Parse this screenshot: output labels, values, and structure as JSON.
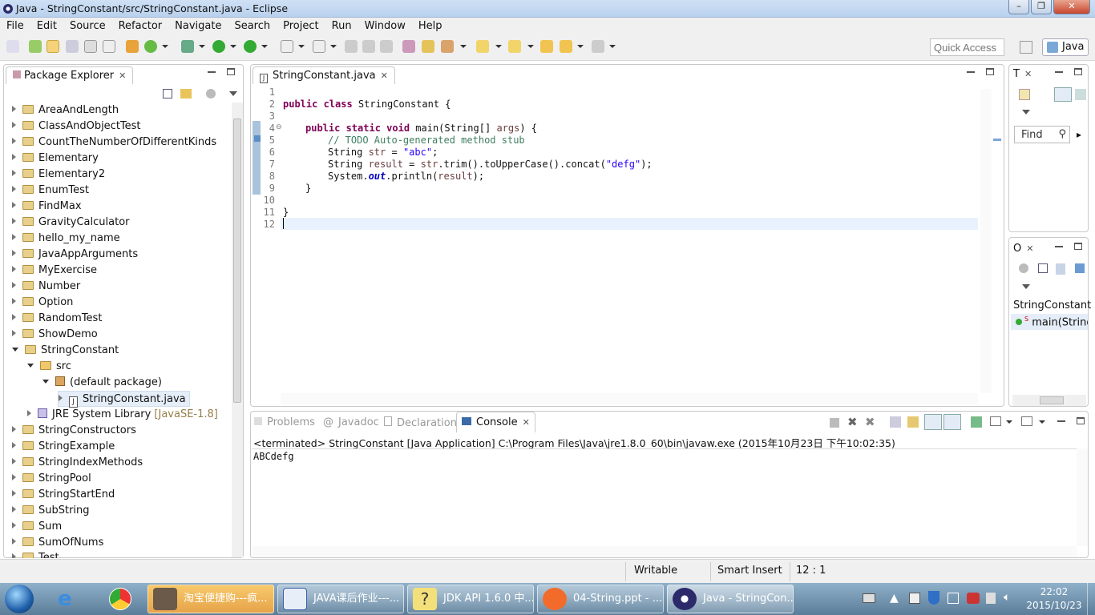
{
  "window": {
    "title": "Java - StringConstant/src/StringConstant.java - Eclipse"
  },
  "menu": [
    "File",
    "Edit",
    "Source",
    "Refactor",
    "Navigate",
    "Search",
    "Project",
    "Run",
    "Window",
    "Help"
  ],
  "toolbar": {
    "quick_access_placeholder": "Quick Access",
    "perspective": "Java"
  },
  "package_explorer": {
    "tab": "Package Explorer",
    "items": [
      {
        "label": "AreaAndLength"
      },
      {
        "label": "ClassAndObjectTest"
      },
      {
        "label": "CountTheNumberOfDifferentKinds"
      },
      {
        "label": "Elementary"
      },
      {
        "label": "Elementary2"
      },
      {
        "label": "EnumTest"
      },
      {
        "label": "FindMax"
      },
      {
        "label": "GravityCalculator"
      },
      {
        "label": "hello_my_name"
      },
      {
        "label": "JavaAppArguments"
      },
      {
        "label": "MyExercise"
      },
      {
        "label": "Number"
      },
      {
        "label": "Option"
      },
      {
        "label": "RandomTest"
      },
      {
        "label": "ShowDemo"
      },
      {
        "label": "StringConstant"
      },
      {
        "label": "src"
      },
      {
        "label": "(default package)"
      },
      {
        "label": "StringConstant.java"
      },
      {
        "label": "JRE System Library"
      },
      {
        "label": "StringConstructors"
      },
      {
        "label": "StringExample"
      },
      {
        "label": "StringIndexMethods"
      },
      {
        "label": "StringPool"
      },
      {
        "label": "StringStartEnd"
      },
      {
        "label": "SubString"
      },
      {
        "label": "Sum"
      },
      {
        "label": "SumOfNums"
      },
      {
        "label": "Test"
      }
    ],
    "jre_suffix": "[JavaSE-1.8]"
  },
  "editor": {
    "tab": "StringConstant.java",
    "line_numbers": [
      "1",
      "2",
      "3",
      "4",
      "5",
      "6",
      "7",
      "8",
      "9",
      "10",
      "11",
      "12"
    ],
    "code": {
      "l2_kw": "public class ",
      "l2_rest": "StringConstant {",
      "l4_kw": "public static void ",
      "l4_rest": "main(String[] ",
      "l4_var": "args",
      "l4_end": ") {",
      "l5": "// TODO Auto-generated method stub",
      "l6_a": "String ",
      "l6_var": "str",
      "l6_b": " = ",
      "l6_str": "\"abc\"",
      "l6_c": ";",
      "l7_a": "String ",
      "l7_var": "result",
      "l7_b": " = ",
      "l7_var2": "str",
      "l7_c": ".trim().toUpperCase().concat(",
      "l7_str": "\"defg\"",
      "l7_d": ");",
      "l8_a": "System.",
      "l8_out": "out",
      "l8_b": ".println(",
      "l8_var": "result",
      "l8_c": ");",
      "l9": "}",
      "l11": "}"
    }
  },
  "outline_top": {
    "tab": "T",
    "find_placeholder": "Find"
  },
  "outline": {
    "tab": "O",
    "class_name": "StringConstant",
    "method": "main(String["
  },
  "bottom_tabs": {
    "problems": "Problems",
    "javadoc": "Javadoc",
    "declaration": "Declaration",
    "console": "Console"
  },
  "console": {
    "header": "<terminated> StringConstant [Java Application] C:\\Program Files\\Java\\jre1.8.0_60\\bin\\javaw.exe (2015年10月23日 下午10:02:35)",
    "output": "ABCdefg"
  },
  "status": {
    "writable": "Writable",
    "insert_mode": "Smart Insert",
    "position": "12 : 1"
  },
  "taskbar": {
    "items": [
      "淘宝便捷购---疯...",
      "JAVA课后作业---...",
      "JDK API 1.6.0 中...",
      "04-String.ppt - ...",
      "Java - StringCon..."
    ],
    "time": "22:02",
    "date": "2015/10/23"
  }
}
